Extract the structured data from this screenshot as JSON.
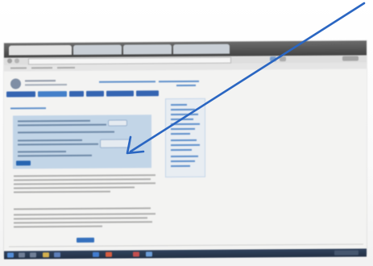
{
  "colors": {
    "arrow": "#2a66c2",
    "page_background": "#fdfdfc",
    "link_blue": "#2f63b6",
    "form_panel": "#c8dcf0",
    "taskbar": "#1f2f48"
  },
  "icons": {
    "arrow_annotation": "arrow-icon",
    "taskbar_icons": [
      "windows-start-icon",
      "search-icon",
      "task-view-icon",
      "file-explorer-icon",
      "store-icon",
      "mail-icon",
      "browser-icon",
      "office-icon",
      "media-icon"
    ]
  }
}
